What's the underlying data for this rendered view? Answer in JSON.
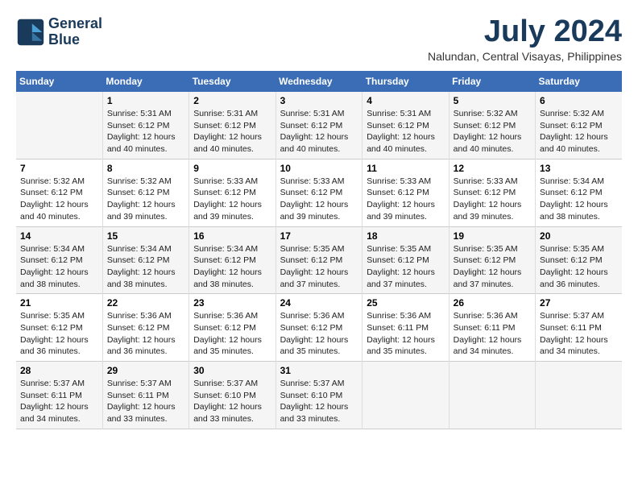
{
  "header": {
    "logo_line1": "General",
    "logo_line2": "Blue",
    "month": "July 2024",
    "location": "Nalundan, Central Visayas, Philippines"
  },
  "weekdays": [
    "Sunday",
    "Monday",
    "Tuesday",
    "Wednesday",
    "Thursday",
    "Friday",
    "Saturday"
  ],
  "weeks": [
    [
      {
        "day": "",
        "info": ""
      },
      {
        "day": "1",
        "info": "Sunrise: 5:31 AM\nSunset: 6:12 PM\nDaylight: 12 hours\nand 40 minutes."
      },
      {
        "day": "2",
        "info": "Sunrise: 5:31 AM\nSunset: 6:12 PM\nDaylight: 12 hours\nand 40 minutes."
      },
      {
        "day": "3",
        "info": "Sunrise: 5:31 AM\nSunset: 6:12 PM\nDaylight: 12 hours\nand 40 minutes."
      },
      {
        "day": "4",
        "info": "Sunrise: 5:31 AM\nSunset: 6:12 PM\nDaylight: 12 hours\nand 40 minutes."
      },
      {
        "day": "5",
        "info": "Sunrise: 5:32 AM\nSunset: 6:12 PM\nDaylight: 12 hours\nand 40 minutes."
      },
      {
        "day": "6",
        "info": "Sunrise: 5:32 AM\nSunset: 6:12 PM\nDaylight: 12 hours\nand 40 minutes."
      }
    ],
    [
      {
        "day": "7",
        "info": "Sunrise: 5:32 AM\nSunset: 6:12 PM\nDaylight: 12 hours\nand 40 minutes."
      },
      {
        "day": "8",
        "info": "Sunrise: 5:32 AM\nSunset: 6:12 PM\nDaylight: 12 hours\nand 39 minutes."
      },
      {
        "day": "9",
        "info": "Sunrise: 5:33 AM\nSunset: 6:12 PM\nDaylight: 12 hours\nand 39 minutes."
      },
      {
        "day": "10",
        "info": "Sunrise: 5:33 AM\nSunset: 6:12 PM\nDaylight: 12 hours\nand 39 minutes."
      },
      {
        "day": "11",
        "info": "Sunrise: 5:33 AM\nSunset: 6:12 PM\nDaylight: 12 hours\nand 39 minutes."
      },
      {
        "day": "12",
        "info": "Sunrise: 5:33 AM\nSunset: 6:12 PM\nDaylight: 12 hours\nand 39 minutes."
      },
      {
        "day": "13",
        "info": "Sunrise: 5:34 AM\nSunset: 6:12 PM\nDaylight: 12 hours\nand 38 minutes."
      }
    ],
    [
      {
        "day": "14",
        "info": "Sunrise: 5:34 AM\nSunset: 6:12 PM\nDaylight: 12 hours\nand 38 minutes."
      },
      {
        "day": "15",
        "info": "Sunrise: 5:34 AM\nSunset: 6:12 PM\nDaylight: 12 hours\nand 38 minutes."
      },
      {
        "day": "16",
        "info": "Sunrise: 5:34 AM\nSunset: 6:12 PM\nDaylight: 12 hours\nand 38 minutes."
      },
      {
        "day": "17",
        "info": "Sunrise: 5:35 AM\nSunset: 6:12 PM\nDaylight: 12 hours\nand 37 minutes."
      },
      {
        "day": "18",
        "info": "Sunrise: 5:35 AM\nSunset: 6:12 PM\nDaylight: 12 hours\nand 37 minutes."
      },
      {
        "day": "19",
        "info": "Sunrise: 5:35 AM\nSunset: 6:12 PM\nDaylight: 12 hours\nand 37 minutes."
      },
      {
        "day": "20",
        "info": "Sunrise: 5:35 AM\nSunset: 6:12 PM\nDaylight: 12 hours\nand 36 minutes."
      }
    ],
    [
      {
        "day": "21",
        "info": "Sunrise: 5:35 AM\nSunset: 6:12 PM\nDaylight: 12 hours\nand 36 minutes."
      },
      {
        "day": "22",
        "info": "Sunrise: 5:36 AM\nSunset: 6:12 PM\nDaylight: 12 hours\nand 36 minutes."
      },
      {
        "day": "23",
        "info": "Sunrise: 5:36 AM\nSunset: 6:12 PM\nDaylight: 12 hours\nand 35 minutes."
      },
      {
        "day": "24",
        "info": "Sunrise: 5:36 AM\nSunset: 6:12 PM\nDaylight: 12 hours\nand 35 minutes."
      },
      {
        "day": "25",
        "info": "Sunrise: 5:36 AM\nSunset: 6:11 PM\nDaylight: 12 hours\nand 35 minutes."
      },
      {
        "day": "26",
        "info": "Sunrise: 5:36 AM\nSunset: 6:11 PM\nDaylight: 12 hours\nand 34 minutes."
      },
      {
        "day": "27",
        "info": "Sunrise: 5:37 AM\nSunset: 6:11 PM\nDaylight: 12 hours\nand 34 minutes."
      }
    ],
    [
      {
        "day": "28",
        "info": "Sunrise: 5:37 AM\nSunset: 6:11 PM\nDaylight: 12 hours\nand 34 minutes."
      },
      {
        "day": "29",
        "info": "Sunrise: 5:37 AM\nSunset: 6:11 PM\nDaylight: 12 hours\nand 33 minutes."
      },
      {
        "day": "30",
        "info": "Sunrise: 5:37 AM\nSunset: 6:10 PM\nDaylight: 12 hours\nand 33 minutes."
      },
      {
        "day": "31",
        "info": "Sunrise: 5:37 AM\nSunset: 6:10 PM\nDaylight: 12 hours\nand 33 minutes."
      },
      {
        "day": "",
        "info": ""
      },
      {
        "day": "",
        "info": ""
      },
      {
        "day": "",
        "info": ""
      }
    ]
  ]
}
